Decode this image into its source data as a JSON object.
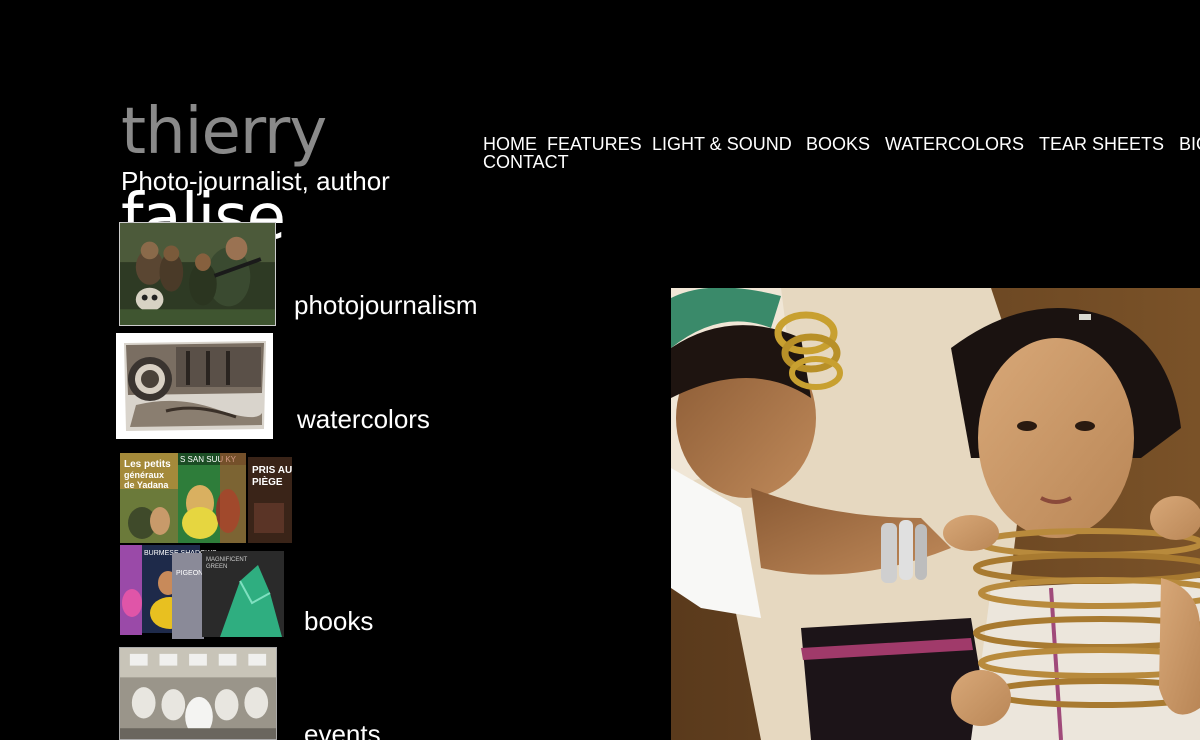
{
  "brand": {
    "first_name": "thierry",
    "last_name": "falise",
    "tagline": "Photo-journalist, author"
  },
  "nav": {
    "items": [
      {
        "label": "HOME"
      },
      {
        "label": "FEATURES"
      },
      {
        "label": "LIGHT & SOUND"
      },
      {
        "label": "BOOKS"
      },
      {
        "label": "WATERCOLORS"
      },
      {
        "label": "TEAR SHEETS"
      },
      {
        "label": "BIO"
      },
      {
        "label": "CONTACT"
      }
    ]
  },
  "sections": [
    {
      "label": "photojournalism"
    },
    {
      "label": "watercolors"
    },
    {
      "label": "books"
    },
    {
      "label": "events"
    }
  ],
  "book_covers": {
    "cover1_title": "Les petits généraux de Yadana",
    "cover2_title": "S SAN SUU KY",
    "cover3_title": "PRIS AU PIÈGE",
    "cover4_title": "BURMESE SHADOWS",
    "cover5_title": "PIGEON",
    "cover6_title": "MAGNIFICENT GREEN"
  }
}
